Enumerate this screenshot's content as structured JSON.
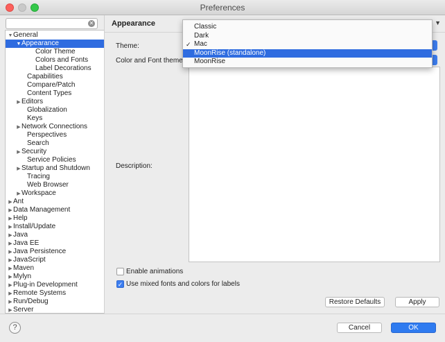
{
  "window": {
    "title": "Preferences"
  },
  "search": {
    "placeholder": ""
  },
  "tree": {
    "items": [
      {
        "label": "General",
        "expander": "▼"
      },
      {
        "label": "Appearance",
        "expander": "▼"
      },
      {
        "label": "Color Theme",
        "expander": ""
      },
      {
        "label": "Colors and Fonts",
        "expander": ""
      },
      {
        "label": "Label Decorations",
        "expander": ""
      },
      {
        "label": "Capabilities",
        "expander": ""
      },
      {
        "label": "Compare/Patch",
        "expander": ""
      },
      {
        "label": "Content Types",
        "expander": ""
      },
      {
        "label": "Editors",
        "expander": "▶"
      },
      {
        "label": "Globalization",
        "expander": ""
      },
      {
        "label": "Keys",
        "expander": ""
      },
      {
        "label": "Network Connections",
        "expander": "▶"
      },
      {
        "label": "Perspectives",
        "expander": ""
      },
      {
        "label": "Search",
        "expander": ""
      },
      {
        "label": "Security",
        "expander": "▶"
      },
      {
        "label": "Service Policies",
        "expander": ""
      },
      {
        "label": "Startup and Shutdown",
        "expander": "▶"
      },
      {
        "label": "Tracing",
        "expander": ""
      },
      {
        "label": "Web Browser",
        "expander": ""
      },
      {
        "label": "Workspace",
        "expander": "▶"
      },
      {
        "label": "Ant",
        "expander": "▶"
      },
      {
        "label": "Data Management",
        "expander": "▶"
      },
      {
        "label": "Help",
        "expander": "▶"
      },
      {
        "label": "Install/Update",
        "expander": "▶"
      },
      {
        "label": "Java",
        "expander": "▶"
      },
      {
        "label": "Java EE",
        "expander": "▶"
      },
      {
        "label": "Java Persistence",
        "expander": "▶"
      },
      {
        "label": "JavaScript",
        "expander": "▶"
      },
      {
        "label": "Maven",
        "expander": "▶"
      },
      {
        "label": "Mylyn",
        "expander": "▶"
      },
      {
        "label": "Plug-in Development",
        "expander": "▶"
      },
      {
        "label": "Remote Systems",
        "expander": "▶"
      },
      {
        "label": "Run/Debug",
        "expander": "▶"
      },
      {
        "label": "Server",
        "expander": "▶"
      }
    ],
    "selected": "Appearance"
  },
  "page": {
    "title": "Appearance",
    "theme_label": "Theme:",
    "color_font_theme_label": "Color and Font theme:",
    "description_label": "Description:",
    "enable_animations_label": "Enable animations",
    "enable_animations_checked": false,
    "mixed_fonts_label": "Use mixed fonts and colors for labels",
    "mixed_fonts_checked": true,
    "restore_defaults_label": "Restore Defaults",
    "apply_label": "Apply"
  },
  "theme_menu": {
    "options": [
      "Classic",
      "Dark",
      "Mac",
      "MoonRise (standalone)",
      "MoonRise"
    ],
    "checked": "Mac",
    "highlighted": "MoonRise (standalone)"
  },
  "footer": {
    "cancel_label": "Cancel",
    "ok_label": "OK",
    "help_glyph": "?"
  },
  "colors": {
    "accent": "#2f6ce0",
    "button_primary": "#2f7bf0"
  }
}
